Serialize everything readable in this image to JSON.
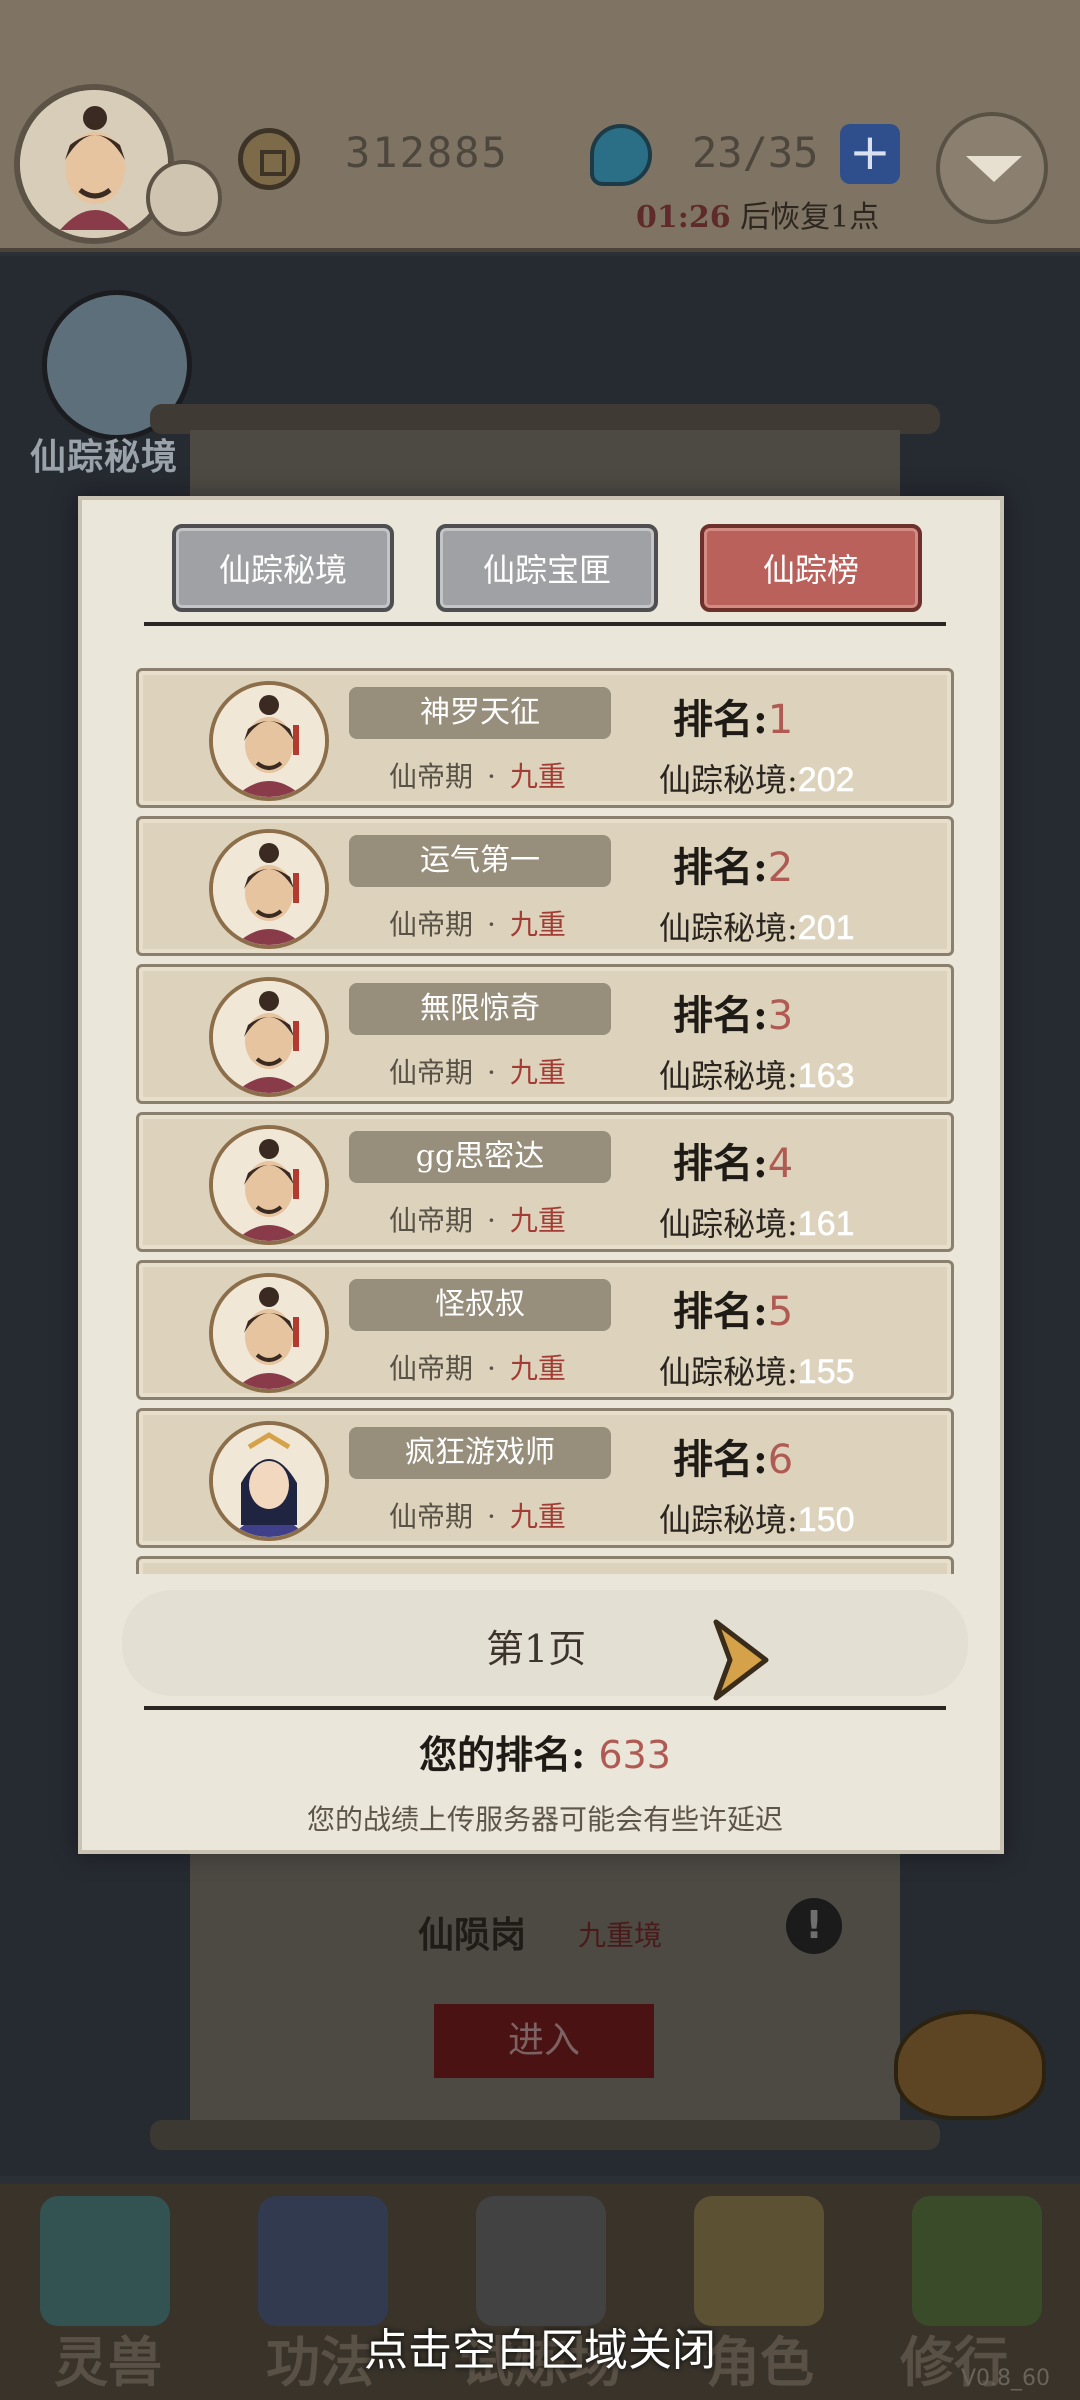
{
  "header": {
    "coins": "312885",
    "stamina": "23/35",
    "plus_label": "+",
    "recovery_time": "01:26",
    "recovery_text": "后恢复1点"
  },
  "side": {
    "secret_realm_label": "仙踪秘境"
  },
  "modal": {
    "tabs": [
      {
        "label": "仙踪秘境",
        "active": false
      },
      {
        "label": "仙踪宝匣",
        "active": false
      },
      {
        "label": "仙踪榜",
        "active": true
      }
    ],
    "rank_label": "排名:",
    "score_label": "仙踪秘境:",
    "entries": [
      {
        "name": "神罗天征",
        "realm": "仙帝期",
        "dot": "·",
        "grade": "九重",
        "rank": "1",
        "score": "202",
        "avatar": "male"
      },
      {
        "name": "运气第一",
        "realm": "仙帝期",
        "dot": "·",
        "grade": "九重",
        "rank": "2",
        "score": "201",
        "avatar": "male"
      },
      {
        "name": "無限惊奇",
        "realm": "仙帝期",
        "dot": "·",
        "grade": "九重",
        "rank": "3",
        "score": "163",
        "avatar": "male"
      },
      {
        "name": "gg思密达",
        "realm": "仙帝期",
        "dot": "·",
        "grade": "九重",
        "rank": "4",
        "score": "161",
        "avatar": "male"
      },
      {
        "name": "怪叔叔",
        "realm": "仙帝期",
        "dot": "·",
        "grade": "九重",
        "rank": "5",
        "score": "155",
        "avatar": "male"
      },
      {
        "name": "疯狂游戏师",
        "realm": "仙帝期",
        "dot": "·",
        "grade": "九重",
        "rank": "6",
        "score": "150",
        "avatar": "female"
      }
    ],
    "page_label": "第1页",
    "my_rank_label": "您的排名:",
    "my_rank_value": "633",
    "note": "您的战绩上传服务器可能会有些许延迟"
  },
  "background_scene": {
    "level_name": "仙陨岗",
    "level_sub": "九重境",
    "info_icon": "!",
    "enter_label": "进入"
  },
  "bottom_nav": {
    "items": [
      "灵兽",
      "功法",
      "试炼场",
      "角色",
      "修行"
    ]
  },
  "close_hint": "点击空白区域关闭",
  "version": "V0.8_60",
  "colors": {
    "active_tab": "#b9615a",
    "inactive_tab": "#a0a1a4",
    "rank_number": "#b05a54",
    "grade_red": "#a33c34"
  }
}
